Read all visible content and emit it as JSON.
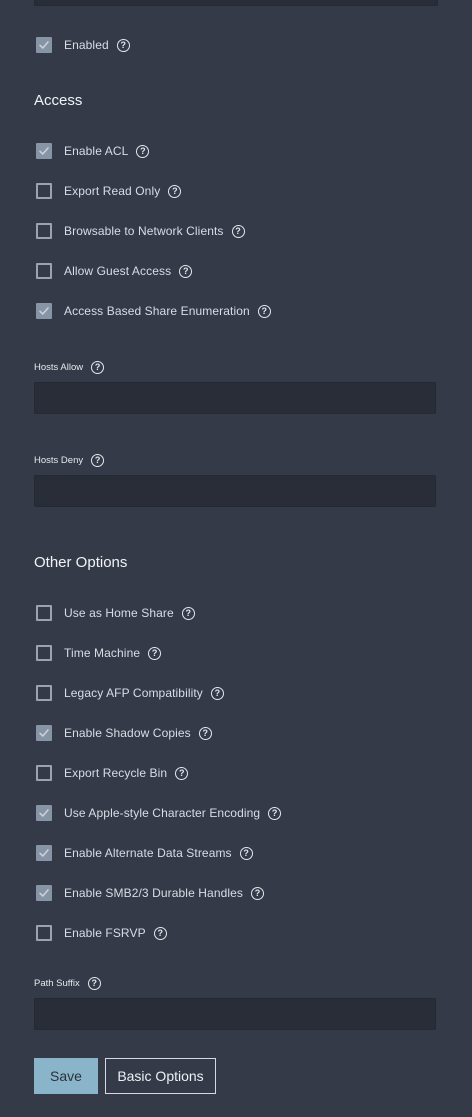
{
  "checkbox_top": [
    {
      "label": "Enabled",
      "checked": true
    }
  ],
  "access": {
    "title": "Access",
    "options": [
      {
        "label": "Enable ACL",
        "checked": true
      },
      {
        "label": "Export Read Only",
        "checked": false
      },
      {
        "label": "Browsable to Network Clients",
        "checked": false
      },
      {
        "label": "Allow Guest Access",
        "checked": false
      },
      {
        "label": "Access Based Share Enumeration",
        "checked": true
      }
    ],
    "hosts_allow": {
      "label": "Hosts Allow",
      "value": ""
    },
    "hosts_deny": {
      "label": "Hosts Deny",
      "value": ""
    }
  },
  "other": {
    "title": "Other Options",
    "options": [
      {
        "label": "Use as Home Share",
        "checked": false
      },
      {
        "label": "Time Machine",
        "checked": false
      },
      {
        "label": "Legacy AFP Compatibility",
        "checked": false
      },
      {
        "label": "Enable Shadow Copies",
        "checked": true
      },
      {
        "label": "Export Recycle Bin",
        "checked": false
      },
      {
        "label": "Use Apple-style Character Encoding",
        "checked": true
      },
      {
        "label": "Enable Alternate Data Streams",
        "checked": true
      },
      {
        "label": "Enable SMB2/3 Durable Handles",
        "checked": true
      },
      {
        "label": "Enable FSRVP",
        "checked": false
      }
    ],
    "path_suffix": {
      "label": "Path Suffix",
      "value": ""
    }
  },
  "buttons": {
    "save": "Save",
    "basic_options": "Basic Options"
  },
  "colors": {
    "background": "#343a48",
    "input_background": "#282d38",
    "checkbox_checked": "#8694a5",
    "primary_button": "#8ab4c9"
  }
}
